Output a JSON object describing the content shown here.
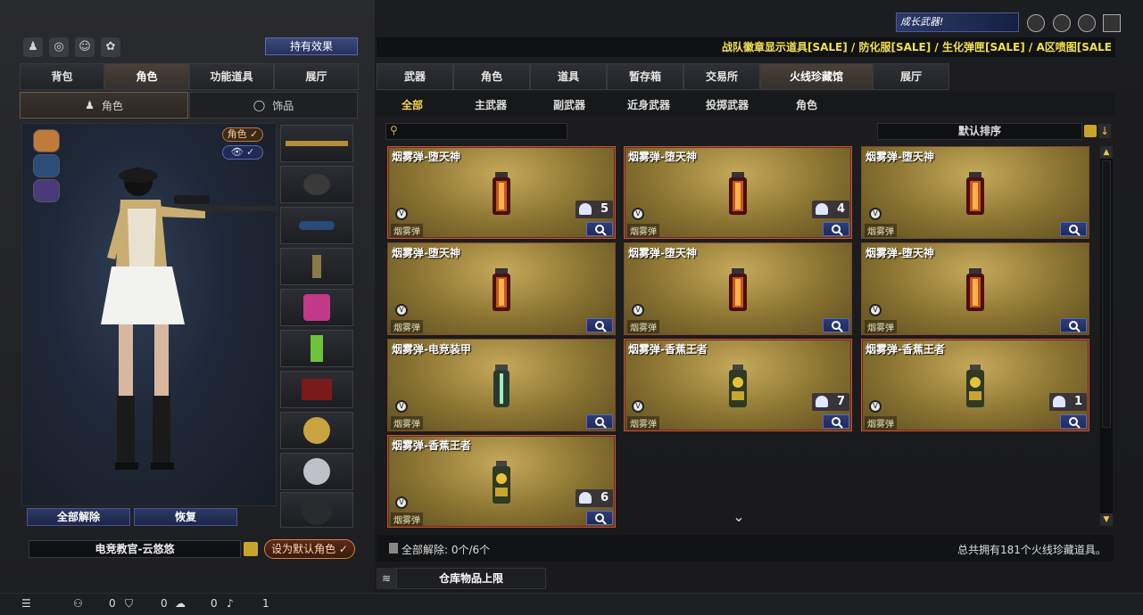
{
  "top_icons": [
    "team-icon",
    "target-icon",
    "user-icon",
    "bag-icon"
  ],
  "hold_effect_label": "持有效果",
  "left_tabs": [
    {
      "label": "背包",
      "active": false
    },
    {
      "label": "角色",
      "active": true
    },
    {
      "label": "功能道具",
      "active": false
    },
    {
      "label": "展厅",
      "active": false
    }
  ],
  "left_subtabs": [
    {
      "label": "角色",
      "active": true
    },
    {
      "label": "饰品",
      "active": false
    }
  ],
  "preview": {
    "toggle_role": "角色 ✓",
    "toggle_eye": "👁 ✓"
  },
  "left_buttons": {
    "unequip_all": "全部解除",
    "restore": "恢复"
  },
  "character_name": "电竞教官-云悠悠",
  "set_default_label": "设为默认角色 ✓",
  "marquee": "战队徽章显示道具[SALE] / 防化服[SALE] / 生化弹匣[SALE] / A区喷图[SALE",
  "top_badge": "成长武器!",
  "top_right_icons": [
    "shield-icon",
    "crosshair-icon",
    "tools-icon",
    "wings-icon"
  ],
  "main_tabs": [
    {
      "label": "武器",
      "active": false
    },
    {
      "label": "角色",
      "active": false
    },
    {
      "label": "道具",
      "active": false
    },
    {
      "label": "暂存箱",
      "active": false
    },
    {
      "label": "交易所",
      "active": false
    },
    {
      "label": "火线珍藏馆",
      "active": true
    },
    {
      "label": "展厅",
      "active": false
    }
  ],
  "filter_tabs": [
    {
      "label": "全部",
      "active": true
    },
    {
      "label": "主武器",
      "active": false
    },
    {
      "label": "副武器",
      "active": false
    },
    {
      "label": "近身武器",
      "active": false
    },
    {
      "label": "投掷武器",
      "active": false
    },
    {
      "label": "角色",
      "active": false
    }
  ],
  "search": {
    "placeholder": ""
  },
  "sort_label": "默认排序",
  "items": [
    {
      "title": "烟雾弹-堕天神",
      "type": "烟雾弹",
      "qty": "5",
      "red": true,
      "style": "red"
    },
    {
      "title": "烟雾弹-堕天神",
      "type": "烟雾弹",
      "qty": "4",
      "red": true,
      "style": "red"
    },
    {
      "title": "烟雾弹-堕天神",
      "type": "烟雾弹",
      "qty": "",
      "red": false,
      "style": "red"
    },
    {
      "title": "烟雾弹-堕天神",
      "type": "烟雾弹",
      "qty": "",
      "red": false,
      "style": "red"
    },
    {
      "title": "烟雾弹-堕天神",
      "type": "烟雾弹",
      "qty": "",
      "red": false,
      "style": "red"
    },
    {
      "title": "烟雾弹-堕天神",
      "type": "烟雾弹",
      "qty": "",
      "red": false,
      "style": "red"
    },
    {
      "title": "烟雾弹-电竞装甲",
      "type": "烟雾弹",
      "qty": "",
      "red": false,
      "style": "green"
    },
    {
      "title": "烟雾弹-香蕉王者",
      "type": "烟雾弹",
      "qty": "7",
      "red": true,
      "style": "gold"
    },
    {
      "title": "烟雾弹-香蕉王者",
      "type": "烟雾弹",
      "qty": "1",
      "red": true,
      "style": "gold"
    },
    {
      "title": "烟雾弹-香蕉王者",
      "type": "烟雾弹",
      "qty": "6",
      "red": true,
      "style": "gold"
    }
  ],
  "bottom": {
    "unequip_status": "全部解除: 0个/6个",
    "total_text": "总共拥有181个火线珍藏道具。"
  },
  "warehouse_label": "仓库物品上限",
  "footer": {
    "count1": "0",
    "count2": "0",
    "count3": "0",
    "count4": "1"
  }
}
